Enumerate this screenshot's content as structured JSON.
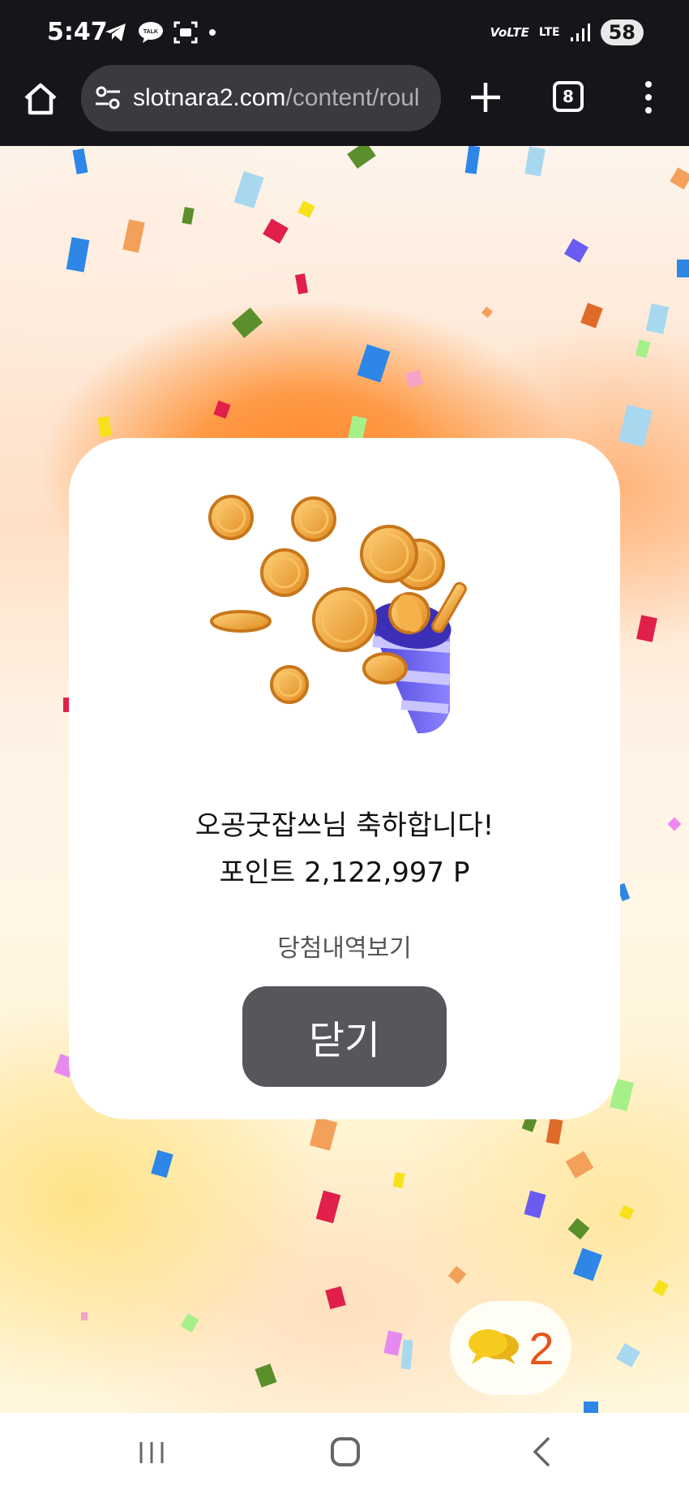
{
  "status_bar": {
    "time": "5:47",
    "battery": "58",
    "icons_left": [
      "telegram-icon",
      "kakaotalk-icon",
      "screenshot-icon",
      "dot-icon"
    ],
    "icons_right": [
      "volte-icon",
      "lte-icon",
      "signal-icon"
    ],
    "volte_label": "VoLTE",
    "lte_label": "LTE"
  },
  "browser": {
    "url_host": "slotnara2.com",
    "url_path": "/content/roul",
    "tab_count": "8"
  },
  "modal": {
    "congrats_text": "오공굿잡쓰님 축하합니다!",
    "points_text": "포인트 2,122,997 P",
    "history_link": "당첨내역보기",
    "close_button": "닫기"
  },
  "chat": {
    "count": "2"
  },
  "colors": {
    "status_bg": "#15151a",
    "url_box_bg": "#3a3b3f",
    "close_button_bg": "#58565a",
    "chat_count": "#e8541b",
    "coin": "#f2a33a",
    "popper_purple": "#6a5cf0"
  }
}
